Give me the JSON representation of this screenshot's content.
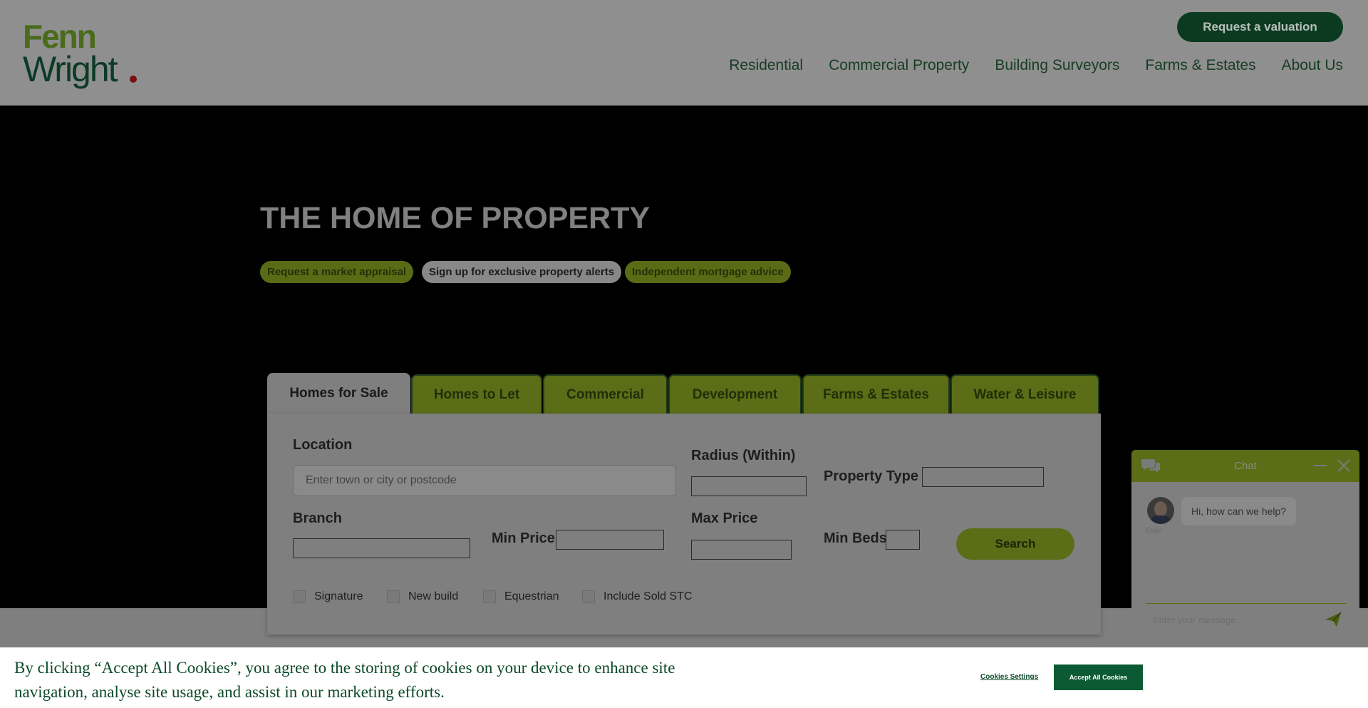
{
  "header": {
    "logo_line1": "Fenn",
    "logo_line2": "Wright",
    "valuation_button": "Request a valuation",
    "nav": [
      "Residential",
      "Commercial Property",
      "Building Surveyors",
      "Farms & Estates",
      "About Us"
    ]
  },
  "hero": {
    "title": "THE HOME OF PROPERTY",
    "pills": [
      "Request a market appraisal",
      "Sign up for exclusive property alerts",
      "Independent mortgage advice"
    ]
  },
  "search": {
    "tabs": [
      "Homes for Sale",
      "Homes to Let",
      "Commercial",
      "Development",
      "Farms & Estates",
      "Water & Leisure"
    ],
    "active_tab": "Homes for Sale",
    "location_label": "Location",
    "location_placeholder": "Enter town or city or postcode",
    "radius_label": "Radius (Within)",
    "property_type_label": "Property Type",
    "branch_label": "Branch",
    "min_price_label": "Min Price",
    "max_price_label": "Max Price",
    "min_beds_label": "Min Beds",
    "search_button": "Search",
    "checkboxes": [
      "Signature",
      "New build",
      "Equestrian",
      "Include Sold STC"
    ]
  },
  "chat": {
    "title": "Chat",
    "agent_name": "Evan",
    "greeting": "Hi, how can we help?",
    "input_placeholder": "Enter your message..."
  },
  "cookie": {
    "text": "By clicking “Accept All Cookies”, you agree to the storing of cookies on your device to enhance site navigation, analyse site usage, and assist in our marketing efforts.",
    "settings_label": "Cookies Settings",
    "accept_label": "Accept All Cookies"
  },
  "colors": {
    "brand_green_dark": "#0b3a21",
    "brand_green_light": "#5b6d16",
    "overlay_grey": "#7f7f7f"
  }
}
